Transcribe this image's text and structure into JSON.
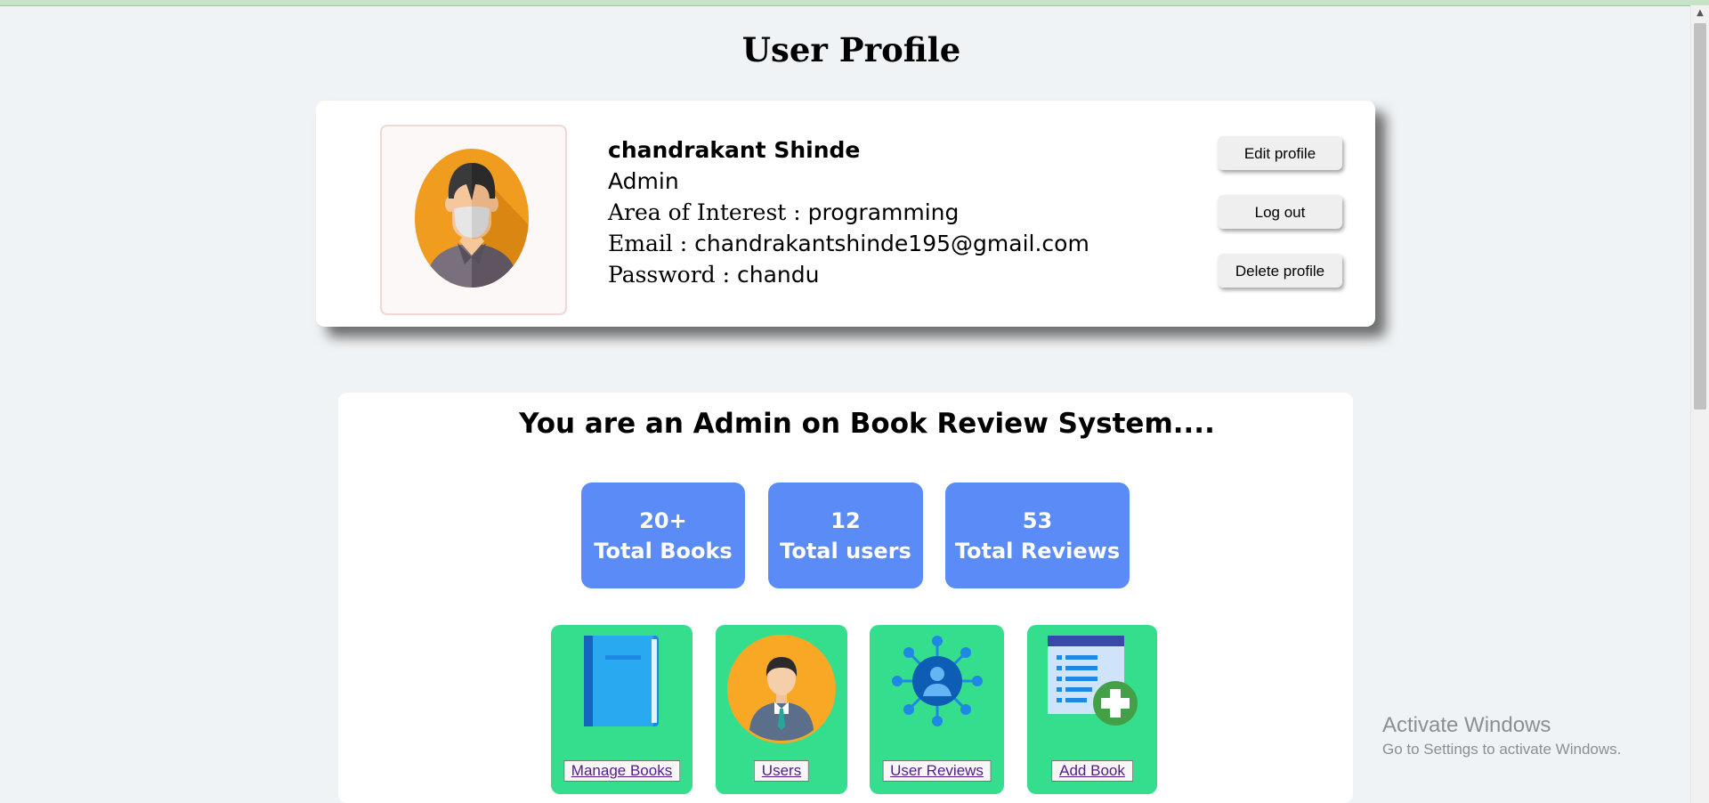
{
  "page": {
    "title": "User Profile"
  },
  "profile": {
    "name": "chandrakant Shinde",
    "role": "Admin",
    "interest_label": "Area of Interest : ",
    "interest": "programming",
    "email_label": "Email : ",
    "email": "chandrakantshinde195@gmail.com",
    "password_label": "Password : ",
    "password": "chandu",
    "buttons": {
      "edit": "Edit profile",
      "logout": "Log out",
      "delete": "Delete profile"
    }
  },
  "admin": {
    "heading": "You are an Admin on Book Review System....",
    "stats": [
      {
        "value": "20+",
        "label": "Total Books"
      },
      {
        "value": "12",
        "label": "Total users"
      },
      {
        "value": "53",
        "label": "Total Reviews"
      }
    ],
    "tiles": [
      {
        "label": "Manage Books",
        "icon": "book-icon"
      },
      {
        "label": "Users",
        "icon": "user-icon"
      },
      {
        "label": "User Reviews",
        "icon": "network-icon"
      },
      {
        "label": "Add Book",
        "icon": "add-document-icon"
      }
    ]
  },
  "watermark": {
    "title": "Activate Windows",
    "subtitle": "Go to Settings to activate Windows."
  },
  "colors": {
    "stat_bg": "#5b8bf6",
    "tile_bg": "#35de8d",
    "link": "#551a8b"
  }
}
